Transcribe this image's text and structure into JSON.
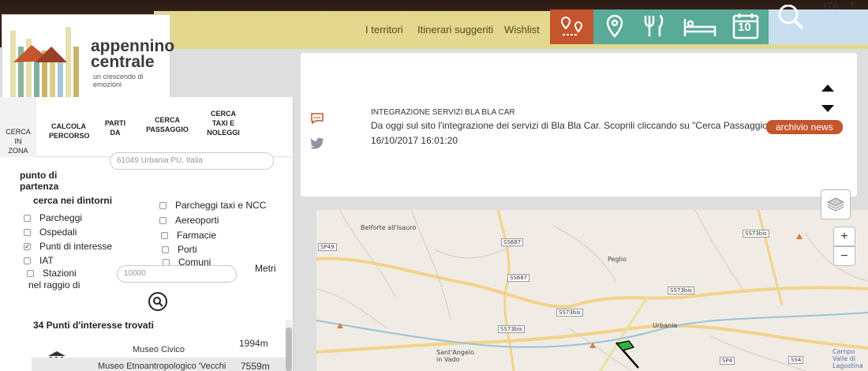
{
  "nav": {
    "links": [
      "I territori",
      "Itinerari suggeriti",
      "Wishlist"
    ],
    "language": "ITA",
    "calendar_day": "10"
  },
  "logo": {
    "title_line1": "appennino",
    "title_line2": "centrale",
    "subtitle": "un crescendo di emozioni"
  },
  "tabs": [
    {
      "label": "CERCA\nIN\nZONA",
      "active": true
    },
    {
      "label": "CALCOLA\nPERCORSO"
    },
    {
      "label": "PARTI\nDA"
    },
    {
      "label": "CERCA\nPASSAGGIO"
    },
    {
      "label": "CERCA\nTAXI E\nNOLEGGI"
    }
  ],
  "search": {
    "start_label": "punto di\npartenza",
    "start_placeholder": "61049 Urbania PU, Italia",
    "nearby_label": "cerca nei dintorni",
    "radius_label": "nel raggio di",
    "radius_placeholder": "10000",
    "radius_unit": "Metri"
  },
  "checkboxes_left": [
    {
      "label": "Parcheggi",
      "checked": false
    },
    {
      "label": "Ospedali",
      "checked": false
    },
    {
      "label": "Punti di interesse",
      "checked": true
    },
    {
      "label": "IAT",
      "checked": false
    },
    {
      "label": "Stazioni",
      "checked": false
    }
  ],
  "checkboxes_right": [
    {
      "label": "Parcheggi taxi e NCC",
      "checked": false
    },
    {
      "label": "Aereoporti",
      "checked": false
    },
    {
      "label": "Farmacie",
      "checked": false
    },
    {
      "label": "Porti",
      "checked": false
    },
    {
      "label": "Comuni",
      "checked": false
    }
  ],
  "results": {
    "title": "34 Punti d'interesse trovati",
    "items": [
      {
        "name": "Museo Civico",
        "distance": "1994m"
      },
      {
        "name": "Museo Etnoantropologico 'Vecchi",
        "distance": "7559m"
      }
    ]
  },
  "news": {
    "heading": "INTEGRAZIONE SERVIZI BLA BLA CAR",
    "body": "Da oggi sul sito l'integrazione dei servizi di Bla Bla Car. Scoprili cliccando su \"Cerca Passaggio\"...",
    "date": "16/10/2017 16:01:20",
    "archive_button": "archivio news"
  },
  "map": {
    "places": [
      "Belforte all'Isauro",
      "Peglio",
      "Urbania",
      "Sant'Angelo in Vado",
      "Campo Valle di Lagostina"
    ],
    "roads": [
      "SP49",
      "SS687",
      "SS73bis",
      "SS687",
      "SS73bis",
      "SS73bis",
      "SS73bis",
      "SP4",
      "SS4"
    ],
    "zoom_in": "+",
    "zoom_out": "−"
  },
  "colors": {
    "menubar": "#e2d88e",
    "orange": "#c4552d",
    "teal": "#5aaa98",
    "light_blue": "#c9dff0"
  }
}
